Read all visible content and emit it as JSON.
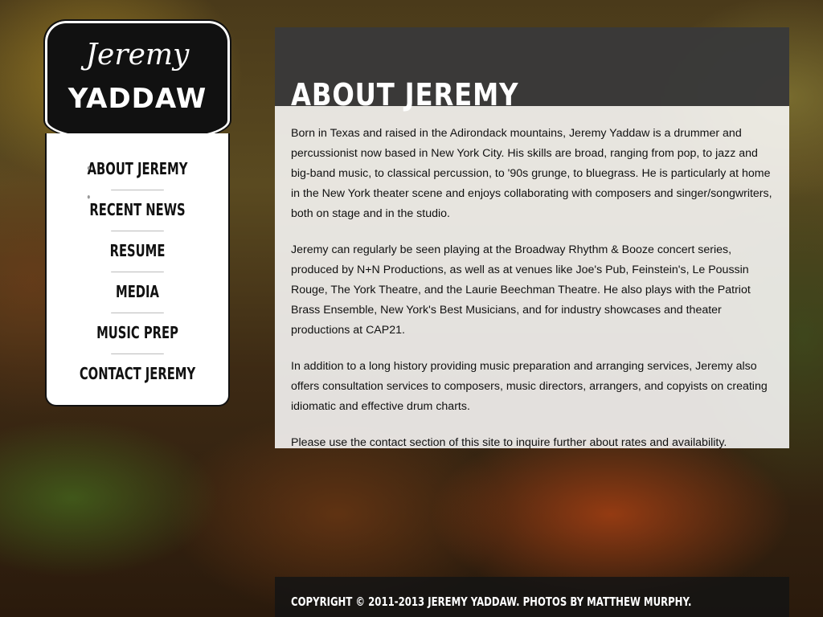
{
  "logo": {
    "script": "Jeremy",
    "name": "YADDAW"
  },
  "nav": {
    "items": [
      {
        "label": "ABOUT JEREMY"
      },
      {
        "label": "RECENT NEWS"
      },
      {
        "label": "RESUME"
      },
      {
        "label": "MEDIA"
      },
      {
        "label": "MUSIC PREP"
      },
      {
        "label": "CONTACT JEREMY"
      }
    ]
  },
  "content": {
    "title": "ABOUT JEREMY",
    "paragraphs": [
      "Born in Texas and raised in the Adirondack mountains, Jeremy Yaddaw is a drummer and percussionist now based in New York City. His skills are broad, ranging from pop, to jazz and big-band music, to classical percussion, to '90s grunge, to bluegrass. He is particularly at home in the New York theater scene and enjoys collaborating with composers and singer/songwriters, both on stage and in the studio.",
      "Jeremy can regularly be seen playing at the Broadway Rhythm & Booze concert series, produced by N+N Productions, as well as at venues like Joe's Pub, Feinstein's, Le Poussin Rouge, The York Theatre, and the Laurie Beechman Theatre. He also plays with the Patriot Brass Ensemble, New York's Best Musicians, and for industry showcases and theater productions at CAP21.",
      "In addition to a long history providing music preparation and arranging services, Jeremy also offers consultation services to composers, music directors, arrangers, and copyists on creating idiomatic and effective drum charts.",
      "Please use the contact section of this site to inquire further about rates and availability."
    ]
  },
  "footer": {
    "text": "COPYRIGHT © 2011-2013 JEREMY YADDAW. PHOTOS BY MATTHEW MURPHY."
  }
}
